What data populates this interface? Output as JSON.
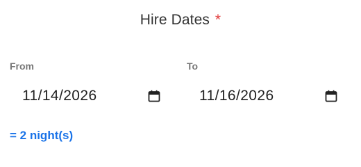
{
  "header": {
    "title": "Hire Dates",
    "required_marker": "*"
  },
  "from": {
    "label": "From",
    "value": "11/14/2026",
    "icon": "calendar-icon"
  },
  "to": {
    "label": "To",
    "value": "11/16/2026",
    "icon": "calendar-icon"
  },
  "summary": {
    "nights_text": "= 2 night(s)"
  },
  "colors": {
    "accent": "#1a73e8",
    "required": "#e03a3a",
    "label": "#777777",
    "text": "#222222"
  }
}
